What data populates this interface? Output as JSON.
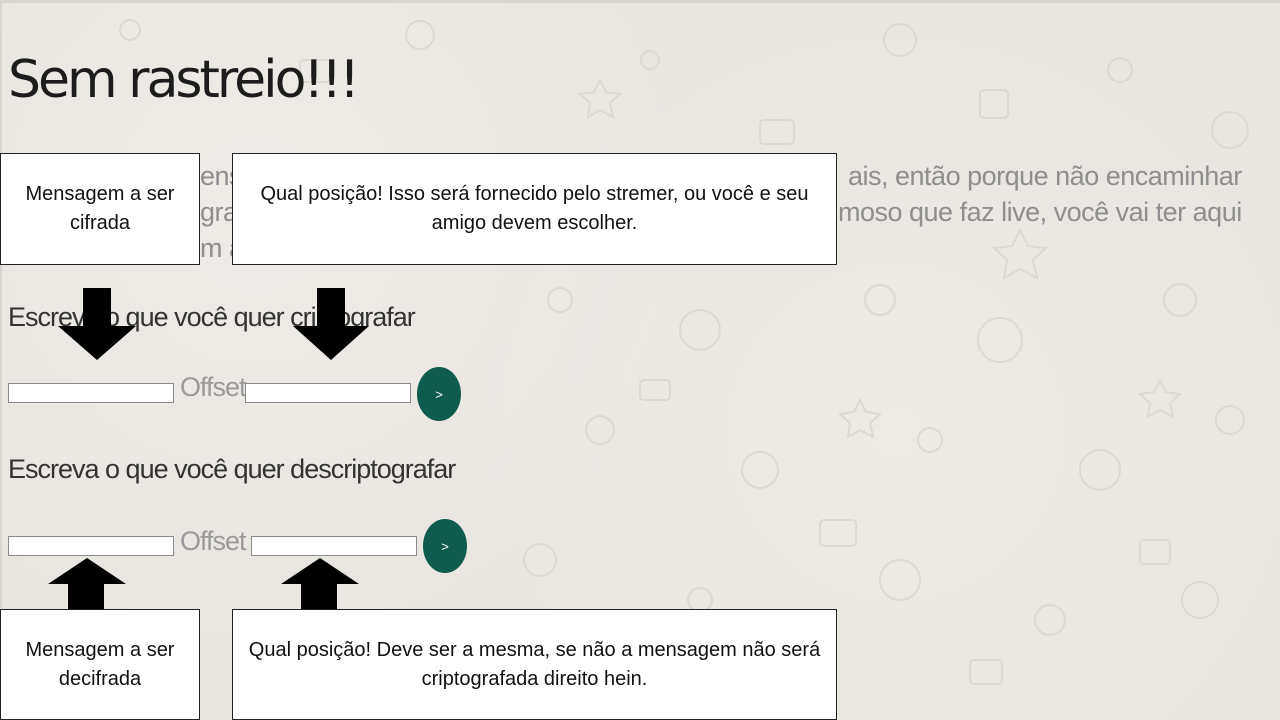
{
  "page": {
    "title": "Sem rastreio!!!",
    "intro_fragments": [
      "ais, então porque não encaminhar",
      "moso que faz live, você vai ter aqui",
      "ens",
      "gra",
      "m a"
    ]
  },
  "encrypt": {
    "label": "Escreva o que você quer criptografar",
    "offset_label": "Offset",
    "button_label": ">"
  },
  "decrypt": {
    "label": "Escreva o que você quer descriptografar",
    "offset_label": "Offset",
    "button_label": ">"
  },
  "callouts": {
    "encrypt_message": "Mensagem a ser cifrada",
    "encrypt_offset": "Qual posição! Isso será fornecido pelo stremer, ou você  e seu amigo devem escolher.",
    "decrypt_message": "Mensagem a ser decifrada",
    "decrypt_offset": "Qual posição! Deve ser a mesma, se não a mensagem não será criptografada direito hein."
  },
  "colors": {
    "button": "#0f5b4e",
    "background": "#e9e5e0",
    "arrow": "#000000"
  }
}
